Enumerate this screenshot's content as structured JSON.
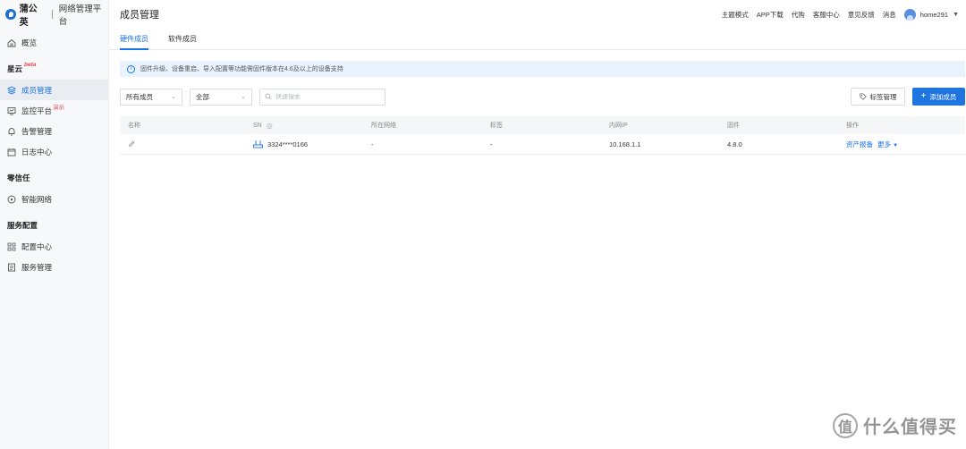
{
  "brand": {
    "name": "蒲公英",
    "subtitle": "网络管理平台"
  },
  "sidebar": {
    "overview": "概览",
    "sections": [
      {
        "title": "星云",
        "badge": "beta",
        "items": [
          {
            "label": "成员管理",
            "icon": "layers-icon",
            "active": true
          },
          {
            "label": "监控平台",
            "icon": "monitor-icon",
            "badge": "演示"
          },
          {
            "label": "告警管理",
            "icon": "bell-icon"
          },
          {
            "label": "日志中心",
            "icon": "calendar-icon"
          }
        ]
      },
      {
        "title": "零信任",
        "items": [
          {
            "label": "智能网络",
            "icon": "network-icon"
          }
        ]
      },
      {
        "title": "服务配置",
        "items": [
          {
            "label": "配置中心",
            "icon": "grid-icon"
          },
          {
            "label": "服务管理",
            "icon": "document-icon"
          }
        ]
      }
    ]
  },
  "header": {
    "title": "成员管理",
    "links": [
      "主题模式",
      "APP下载",
      "代购",
      "客服中心",
      "意见反馈",
      "消息"
    ],
    "username": "home291"
  },
  "tabs": [
    "硬件成员",
    "软件成员"
  ],
  "notice": "固件升级、设备重启、导入配置等功能需固件版本在4.6及以上的设备支持",
  "toolbar": {
    "filter1": "所有成员",
    "filter2": "全部",
    "search_placeholder": "快速搜索",
    "tag_button": "标签管理",
    "add_button": "添加成员"
  },
  "table": {
    "headers": [
      "名称",
      "SN",
      "所在网络",
      "标签",
      "内网IP",
      "固件",
      "操作"
    ],
    "rows": [
      {
        "sn": "3324****0166",
        "network": "-",
        "tag": "-",
        "ip": "10.168.1.1",
        "firmware": "4.8.0",
        "action_report": "资产报备",
        "action_more": "更多"
      }
    ]
  },
  "watermark": {
    "glyph": "值",
    "text": "什么值得买"
  },
  "colors": {
    "accent": "#1a73e8",
    "primary_button": "#1f75e0",
    "notice_bg": "#e8f3fd",
    "badge": "#e5484d"
  }
}
